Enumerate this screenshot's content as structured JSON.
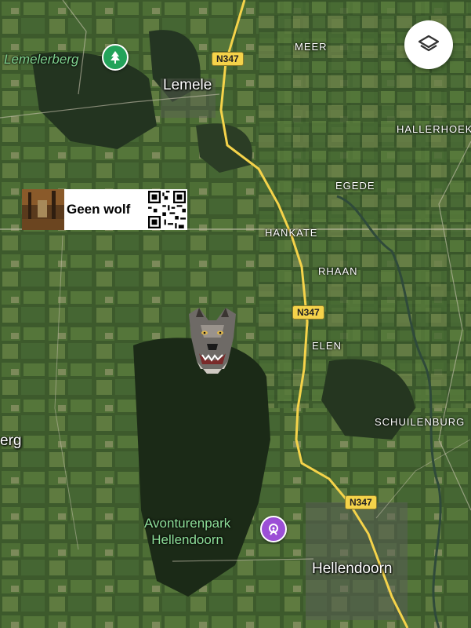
{
  "map": {
    "places": {
      "lemele": "Lemele",
      "hellendoorn": "Hellendoorn",
      "meer": "MEER",
      "hallerhoek": "HALLERHOEK",
      "egede": "EGEDE",
      "hankate": "HANKATE",
      "rhaan": "RHAAN",
      "elen": "ELEN",
      "schuilenburg": "SCHUILENBURG",
      "erg_partial": "erg"
    },
    "poi": {
      "lemelerberg": "Lemelerberg",
      "avonturenpark_line1": "Avonturenpark",
      "avonturenpark_line2": "Hellendoorn"
    },
    "road_shields": [
      "N347",
      "N347",
      "N347"
    ],
    "road_color": "#f5d34a",
    "nature_pin_color": "#23a35a",
    "attraction_pin_color": "#9c4fd6"
  },
  "overlay": {
    "banner_text": "Geen wolf"
  },
  "controls": {
    "layers_icon": "layers-icon"
  }
}
